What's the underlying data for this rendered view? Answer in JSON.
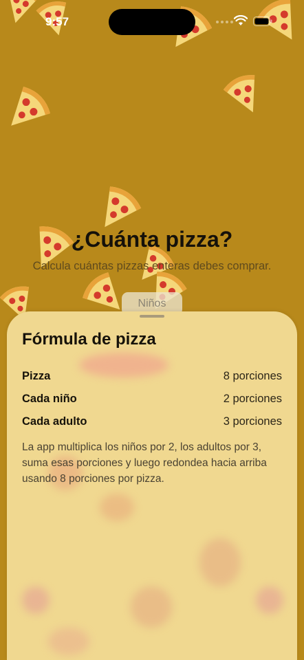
{
  "status_bar": {
    "time": "9:57"
  },
  "hero": {
    "title": "¿Cuánta pizza?",
    "subtitle": "Calcula cuántas pizzas enteras debes comprar.",
    "segment_label": "Niños"
  },
  "sheet": {
    "title": "Fórmula de pizza",
    "rows": [
      {
        "label": "Pizza",
        "value": "8 porciones"
      },
      {
        "label": "Cada niño",
        "value": "2 porciones"
      },
      {
        "label": "Cada adulto",
        "value": "3 porciones"
      }
    ],
    "note": "La app multiplica los niños por 2, los adultos por 3, suma esas porciones y luego redondea hacia arriba usando 8 porciones por pizza."
  },
  "colors": {
    "background": "#b8891b",
    "sheet": "#f0d890",
    "pizza_crust": "#e8a33a",
    "pizza_cheese": "#f5d77a",
    "pepperoni": "#d43a2c"
  },
  "icons": [
    "pizza-slice-icon",
    "wifi-icon",
    "battery-icon"
  ]
}
